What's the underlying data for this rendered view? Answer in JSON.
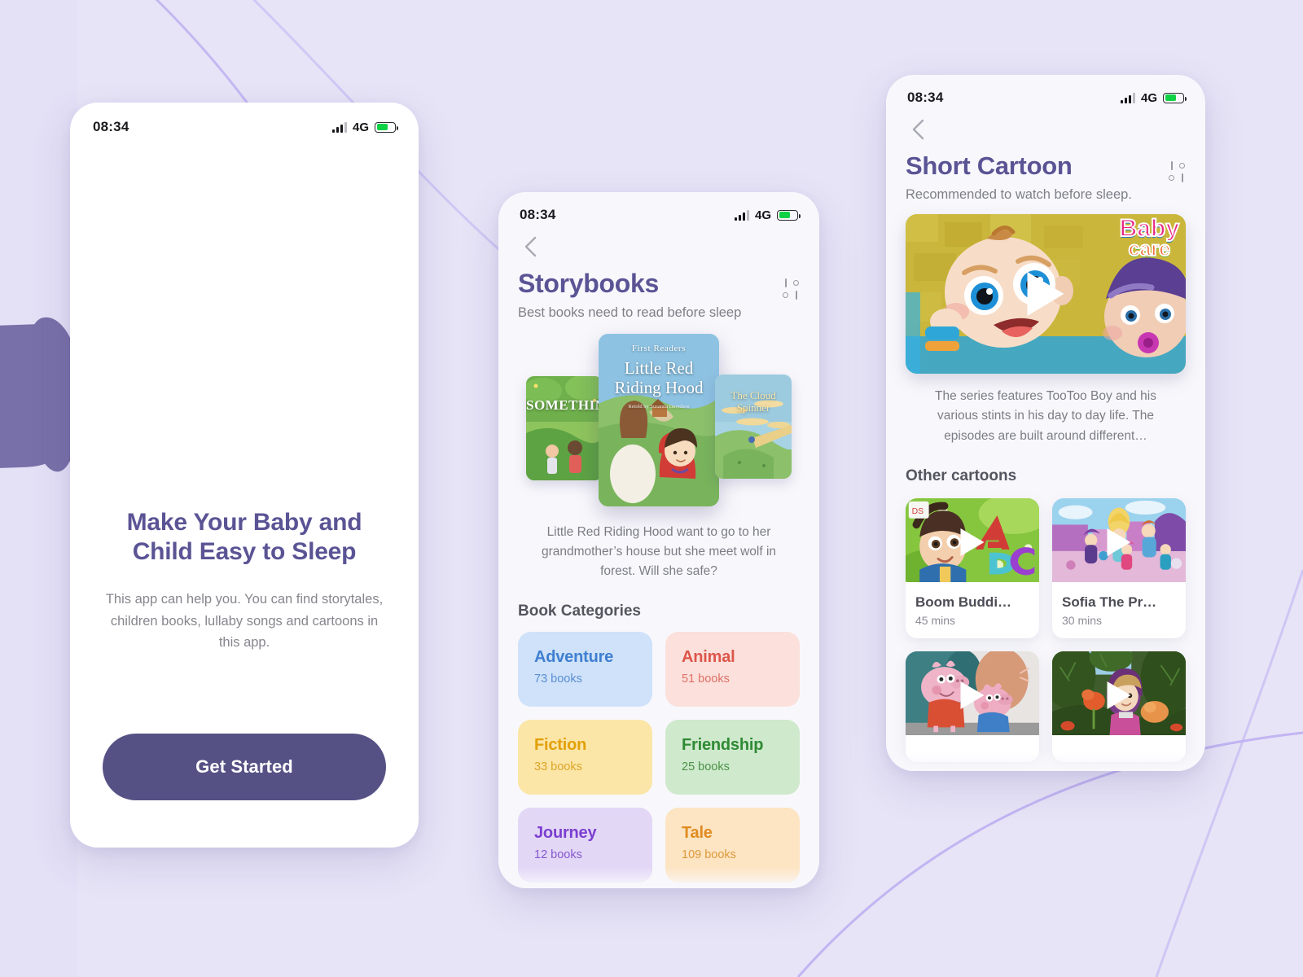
{
  "statusbar": {
    "time": "08:34",
    "network": "4G",
    "signal_icon": "signal-bars-icon",
    "battery_icon": "battery-icon"
  },
  "background": {
    "base_color": "#e7e4f7",
    "pillow_color": "#7870a8",
    "line_color": "#b9a9f0"
  },
  "onboarding": {
    "title": "Make Your Baby and Child Easy to Sleep",
    "subtitle": "This app can help you. You can find storytales, children books, lullaby songs and cartoons in this app.",
    "cta_label": "Get Started",
    "cta_color": "#565185"
  },
  "storybooks": {
    "back_icon": "chevron-left-icon",
    "filter_icon": "filter-settings-icon",
    "title": "Storybooks",
    "subtitle": "Best books need to read before sleep",
    "books": [
      {
        "title": "SOMETHING",
        "position": "left"
      },
      {
        "title": "Little Red Riding Hood",
        "series": "First Readers",
        "byline": "Retold by Susanna Davidson",
        "position": "center"
      },
      {
        "title": "The Cloud Spinner",
        "position": "right"
      }
    ],
    "featured_description": "Little Red Riding Hood want to go to her grandmother’s house but she meet wolf in forest. Will she safe?",
    "categories_heading": "Book Categories",
    "categories": [
      {
        "name": "Adventure",
        "count": "73 books",
        "bg": "#cfe2f9",
        "fg": "#3f7fd0"
      },
      {
        "name": "Animal",
        "count": "51 books",
        "bg": "#fbe0dc",
        "fg": "#dd564a"
      },
      {
        "name": "Fiction",
        "count": "33 books",
        "bg": "#fbe6a8",
        "fg": "#e3a008"
      },
      {
        "name": "Friendship",
        "count": "25 books",
        "bg": "#cfe9cd",
        "fg": "#2f8a33"
      },
      {
        "name": "Journey",
        "count": "12 books",
        "bg": "#e3d7f6",
        "fg": "#7b3fd0"
      },
      {
        "name": "Tale",
        "count": "109 books",
        "bg": "#fde4c2",
        "fg": "#e08c20"
      }
    ]
  },
  "cartoons": {
    "back_icon": "chevron-left-icon",
    "filter_icon": "filter-settings-icon",
    "title": "Short Cartoon",
    "subtitle": "Recommended to watch before sleep.",
    "hero": {
      "play_icon": "play-icon",
      "brand_text": "Baby care"
    },
    "hero_description": "The series features TooToo Boy and his various stints in his day to day life. The episodes are built around different…",
    "other_heading": "Other cartoons",
    "videos": [
      {
        "title": "Boom Buddi…",
        "duration": "45 mins",
        "play_icon": "play-icon",
        "thumb": "abc-letters"
      },
      {
        "title": "Sofia The Pr…",
        "duration": "30 mins",
        "play_icon": "play-icon",
        "thumb": "shimmer-scene"
      },
      {
        "title": "",
        "duration": "",
        "play_icon": "play-icon",
        "thumb": "pig-siblings"
      },
      {
        "title": "",
        "duration": "",
        "play_icon": "play-icon",
        "thumb": "forest-girl"
      }
    ]
  }
}
